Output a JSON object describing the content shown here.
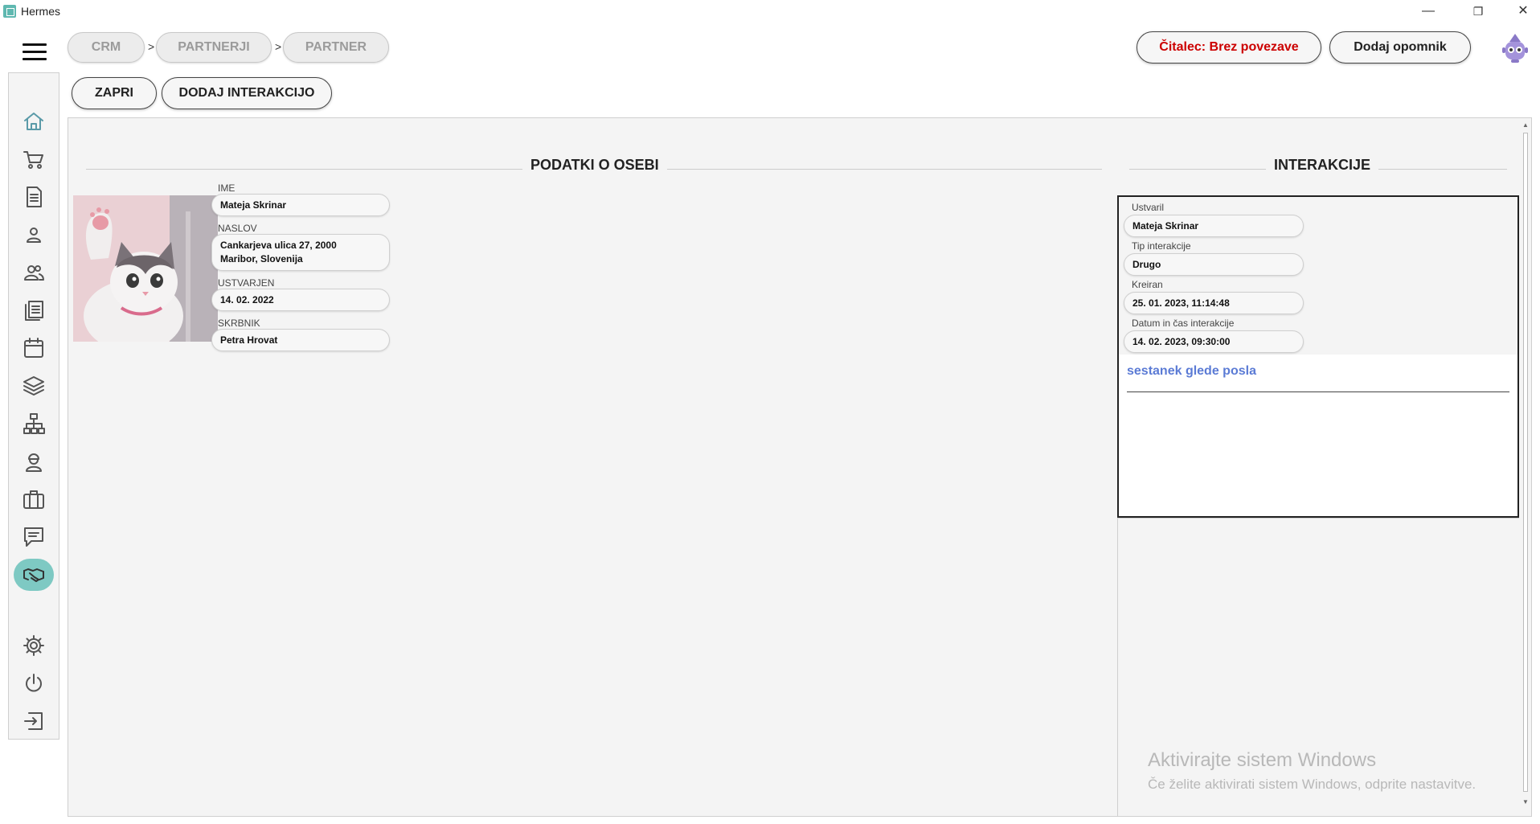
{
  "window": {
    "title": "Hermes",
    "minimize": "—",
    "restore": "❐",
    "close": "✕"
  },
  "breadcrumb": {
    "items": [
      "CRM",
      "PARTNERJI",
      "PARTNER"
    ],
    "separator": ">"
  },
  "header": {
    "reader_status": "Čitalec: Brez povezave",
    "reminder_button": "Dodaj opomnik"
  },
  "actions": {
    "close": "ZAPRI",
    "add_interaction": "DODAJ INTERAKCIJO"
  },
  "sidebar": {
    "items": [
      {
        "name": "home-icon",
        "active": false
      },
      {
        "name": "cart-icon",
        "active": false
      },
      {
        "name": "document-icon",
        "active": false
      },
      {
        "name": "person-icon",
        "active": false
      },
      {
        "name": "people-icon",
        "active": false
      },
      {
        "name": "list-icon",
        "active": false
      },
      {
        "name": "calendar-icon",
        "active": false
      },
      {
        "name": "layers-icon",
        "active": false
      },
      {
        "name": "sitemap-icon",
        "active": false
      },
      {
        "name": "worker-icon",
        "active": false
      },
      {
        "name": "briefcase-icon",
        "active": false
      },
      {
        "name": "chat-icon",
        "active": false
      },
      {
        "name": "handshake-icon",
        "active": true
      },
      {
        "name": "gear-icon",
        "active": false
      },
      {
        "name": "power-icon",
        "active": false
      },
      {
        "name": "logout-icon",
        "active": false
      }
    ],
    "active_color": "#7ec9c3"
  },
  "person": {
    "section_title": "PODATKI O OSEBI",
    "name_label": "IME",
    "name": "Mateja Skrinar",
    "address_label": "NASLOV",
    "address_line1": "Cankarjeva ulica 27, 2000",
    "address_line2": "Maribor, Slovenija",
    "created_label": "USTVARJEN",
    "created": "14. 02. 2022",
    "guardian_label": "SKRBNIK",
    "guardian": "Petra Hrovat"
  },
  "interactions": {
    "section_title": "INTERAKCIJE",
    "items": [
      {
        "created_by_label": "Ustvaril",
        "created_by": "Mateja Skrinar",
        "type_label": "Tip interakcije",
        "type": "Drugo",
        "created_label": "Kreiran",
        "created": "25. 01. 2023, 11:14:48",
        "datetime_label": "Datum in čas interakcije",
        "datetime": "14. 02. 2023, 09:30:00",
        "note": "sestanek glede posla"
      }
    ],
    "note_color": "#5b7bd5"
  },
  "watermark": {
    "line1": "Aktivirajte sistem Windows",
    "line2": "Če želite aktivirati sistem Windows, odprite nastavitve."
  }
}
